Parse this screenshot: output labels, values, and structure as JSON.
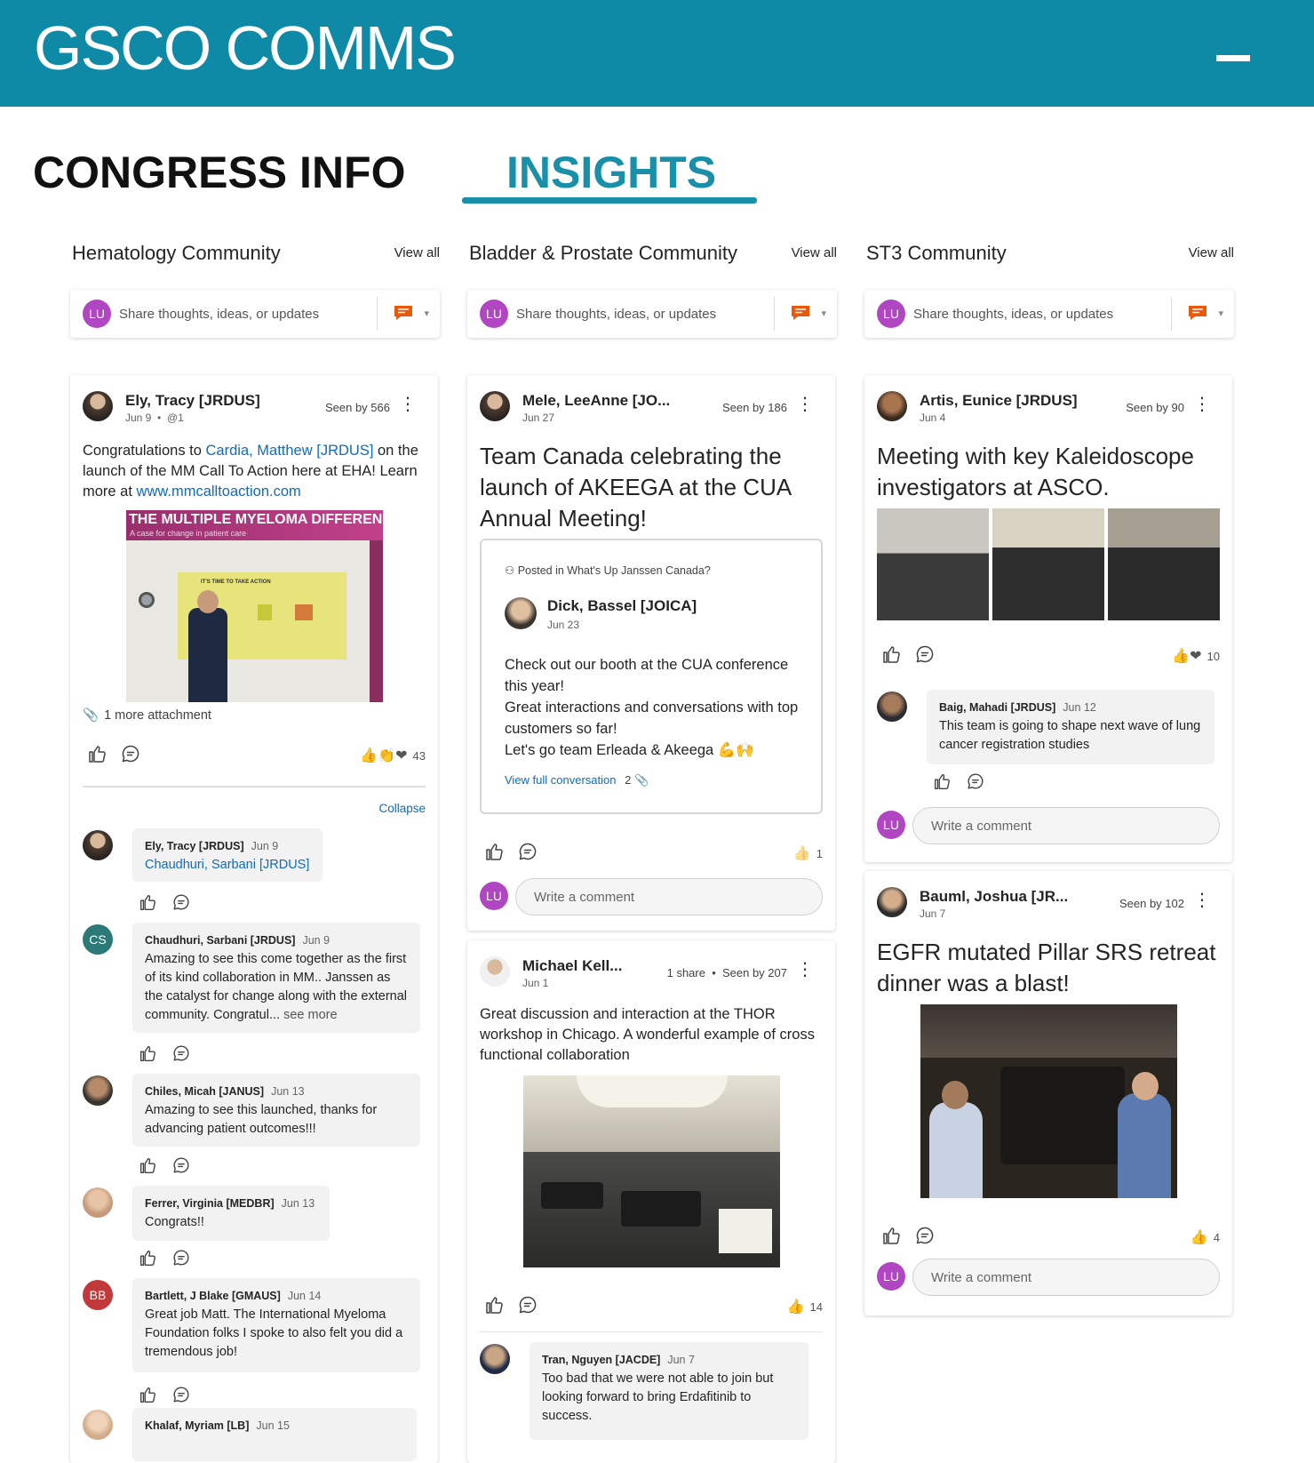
{
  "app": {
    "title": "GSCO COMMS"
  },
  "nav": {
    "tab_congress": "CONGRESS INFO",
    "tab_insights": "INSIGHTS",
    "active": "INSIGHTS"
  },
  "colors": {
    "brand": "#0e8aa6",
    "accent": "#1a8fa8",
    "avatar_lu": "#b146c2",
    "link": "#0f6cbd"
  },
  "share_placeholder": "Share thoughts, ideas, or updates",
  "me_initials": "LU",
  "write_comment_placeholder": "Write a comment",
  "communities": [
    {
      "title": "Hematology Community",
      "view_all": "View all",
      "post": {
        "author": "Ely, Tracy [JRDUS]",
        "date": "Jun 9",
        "mention": "@1",
        "seen": "Seen by 566",
        "text_pre": "Congratulations to ",
        "mention_name": "Cardia, Matthew  [JRDUS]",
        "text_mid": " on the launch of the MM Call To Action here at EHA! Learn more at ",
        "url": "www.mmcalltoaction.com",
        "image_banner": "THE MULTIPLE MYELOMA DIFFEREN",
        "image_subbanner": "A case for change in patient care",
        "image_poster_title": "IT'S TIME TO TAKE ACTION",
        "attachment": "1 more attachment",
        "reaction_emojis": "👍👏❤",
        "reaction_count": "43",
        "collapse": "Collapse",
        "comments": [
          {
            "name": "Ely, Tracy [JRDUS]",
            "date": "Jun 9",
            "text": "Chaudhuri, Sarbani [JRDUS]",
            "is_mention": true
          },
          {
            "name": "Chaudhuri, Sarbani [JRDUS]",
            "date": "Jun 9",
            "initials": "CS",
            "text": "Amazing to see this come together as the first of its kind collaboration in MM.. Janssen as the catalyst for change along with the external community. Congratul...",
            "see_more": "see more"
          },
          {
            "name": "Chiles, Micah [JANUS]",
            "date": "Jun 13",
            "text": "Amazing to see this launched, thanks for advancing patient outcomes!!!"
          },
          {
            "name": "Ferrer, Virginia [MEDBR]",
            "date": "Jun 13",
            "text": "Congrats!!"
          },
          {
            "name": "Bartlett, J Blake [GMAUS]",
            "date": "Jun 14",
            "initials": "BB",
            "text": "Great job Matt. The International Myeloma Foundation folks I spoke to also felt you did a tremendous job!"
          },
          {
            "name": "Khalaf, Myriam [LB]",
            "date": "Jun 15",
            "text": ""
          }
        ]
      }
    },
    {
      "title": "Bladder & Prostate Community",
      "view_all": "View all",
      "post": {
        "author": "Mele, LeeAnne [JO...",
        "date": "Jun 27",
        "seen": "Seen by 186",
        "headline": "Team Canada celebrating the launch of AKEEGA at the CUA Annual Meeting!",
        "shared_from": "Posted in What's Up Janssen Canada?",
        "shared_author": "Dick, Bassel [JOICA]",
        "shared_date": "Jun 23",
        "shared_text": "Check out our booth at the CUA conference this year!\nGreat interactions and conversations with top customers so far!\nLet's go team Erleada & Akeega 💪🙌",
        "view_full": "View full conversation",
        "attach_count": "2",
        "reaction_emojis": "👍",
        "reaction_count": "1"
      },
      "post2": {
        "author": "Michael Kell...",
        "date": "Jun 1",
        "shares": "1 share",
        "seen": "Seen by 207",
        "text": "Great discussion and interaction at the THOR workshop in Chicago. A wonderful example of cross functional collaboration",
        "reaction_emojis": "👍",
        "reaction_count": "14",
        "comment": {
          "name": "Tran, Nguyen [JACDE]",
          "date": "Jun 7",
          "text": "Too bad that we were not able to join but looking forward to bring Erdafitinib to success."
        }
      }
    },
    {
      "title": "ST3 Community",
      "view_all": "View all",
      "post": {
        "author": "Artis, Eunice [JRDUS]",
        "date": "Jun 4",
        "seen": "Seen by 90",
        "headline": "Meeting with key Kaleidoscope investigators at ASCO.",
        "reaction_emojis": "👍❤",
        "reaction_count": "10",
        "comment": {
          "name": "Baig, Mahadi [JRDUS]",
          "date": "Jun 12",
          "text": "This team is going to shape next wave of lung cancer registration studies"
        }
      },
      "post2": {
        "author": "Bauml, Joshua [JR...",
        "date": "Jun 7",
        "seen": "Seen by 102",
        "headline": "EGFR mutated Pillar SRS retreat dinner was a blast!",
        "reaction_emojis": "👍",
        "reaction_count": "4"
      }
    }
  ]
}
